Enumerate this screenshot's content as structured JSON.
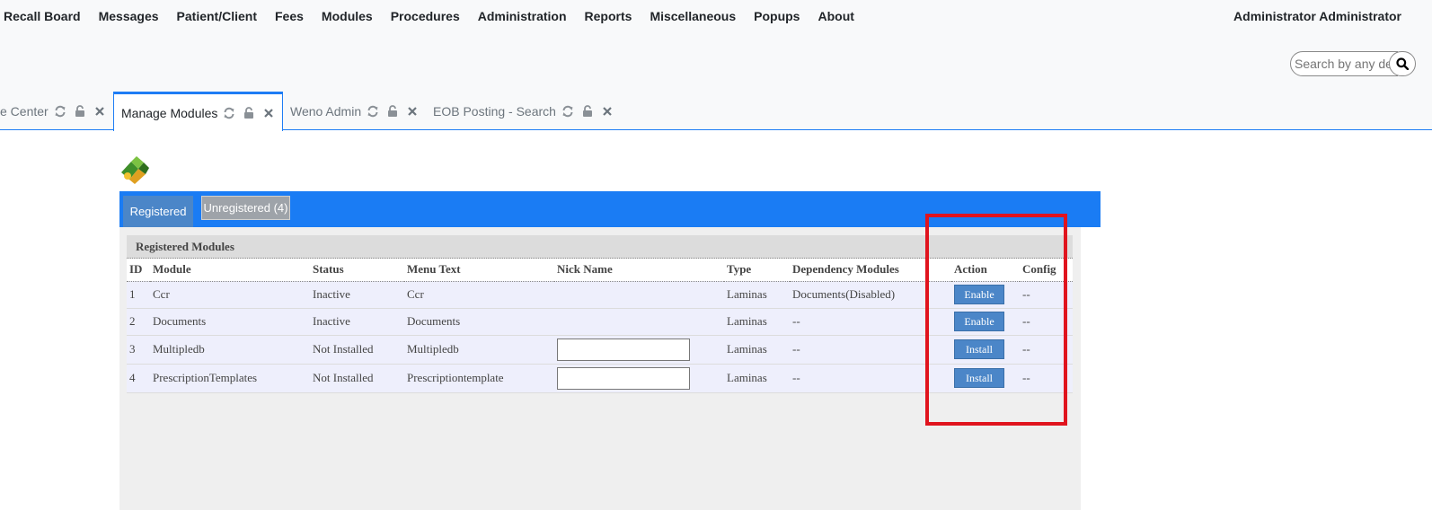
{
  "menu": {
    "items": [
      "Recall Board",
      "Messages",
      "Patient/Client",
      "Fees",
      "Modules",
      "Procedures",
      "Administration",
      "Reports",
      "Miscellaneous",
      "Popups",
      "About"
    ],
    "user": "Administrator Administrator"
  },
  "search": {
    "placeholder": "Search by any demographics"
  },
  "tabs": [
    {
      "label": "e Center",
      "active": false
    },
    {
      "label": "Manage Modules",
      "active": true
    },
    {
      "label": "Weno Admin",
      "active": false
    },
    {
      "label": "EOB Posting - Search",
      "active": false
    }
  ],
  "panel": {
    "tab_registered": "Registered",
    "tab_unregistered": "Unregistered (4)",
    "section_title": "Registered Modules"
  },
  "table": {
    "headers": [
      "ID",
      "Module",
      "Status",
      "Menu Text",
      "Nick Name",
      "Type",
      "Dependency Modules",
      "Action",
      "Config"
    ],
    "rows": [
      {
        "id": "1",
        "module": "Ccr",
        "status": "Inactive",
        "menu_text": "Ccr",
        "nick": null,
        "type": "Laminas",
        "dependency": "Documents(Disabled)",
        "action": "Enable",
        "config": "--"
      },
      {
        "id": "2",
        "module": "Documents",
        "status": "Inactive",
        "menu_text": "Documents",
        "nick": null,
        "type": "Laminas",
        "dependency": "--",
        "action": "Enable",
        "config": "--"
      },
      {
        "id": "3",
        "module": "Multipledb",
        "status": "Not Installed",
        "menu_text": "Multipledb",
        "nick": "",
        "type": "Laminas",
        "dependency": "--",
        "action": "Install",
        "config": "--"
      },
      {
        "id": "4",
        "module": "PrescriptionTemplates",
        "status": "Not Installed",
        "menu_text": "Prescriptiontemplate",
        "nick": "",
        "type": "Laminas",
        "dependency": "--",
        "action": "Install",
        "config": "--"
      }
    ]
  },
  "colors": {
    "accent": "#1a7cf4",
    "button": "#4b86c8",
    "highlight": "#e0141e",
    "row_bg": "#eeeffc"
  }
}
